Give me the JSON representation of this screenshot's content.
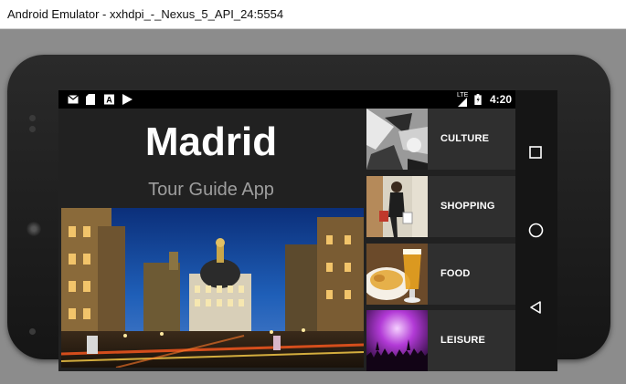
{
  "window": {
    "title": "Android Emulator - xxhdpi_-_Nexus_5_API_24:5554"
  },
  "status_bar": {
    "time": "4:20",
    "network_label": "LTE",
    "notification_icons": [
      "mail-icon",
      "sd-card-icon",
      "a-icon",
      "play-store-icon"
    ],
    "status_icons": [
      "signal-icon",
      "battery-icon"
    ]
  },
  "app": {
    "title": "Madrid",
    "subtitle": "Tour Guide App",
    "categories": [
      {
        "label": "CULTURE",
        "thumb_icon": "guernica-painting-thumbnail"
      },
      {
        "label": "SHOPPING",
        "thumb_icon": "shopping-person-thumbnail"
      },
      {
        "label": "FOOD",
        "thumb_icon": "food-beer-thumbnail"
      },
      {
        "label": "LEISURE",
        "thumb_icon": "concert-crowd-thumbnail"
      }
    ]
  },
  "nav_bar": {
    "buttons": [
      "recents-icon",
      "home-icon",
      "back-icon"
    ]
  },
  "colors": {
    "app_background": "#212121",
    "category_tile": "#2f2f2f",
    "subtitle_text": "#9e9e9e",
    "emulator_background": "#8c8c8c"
  }
}
